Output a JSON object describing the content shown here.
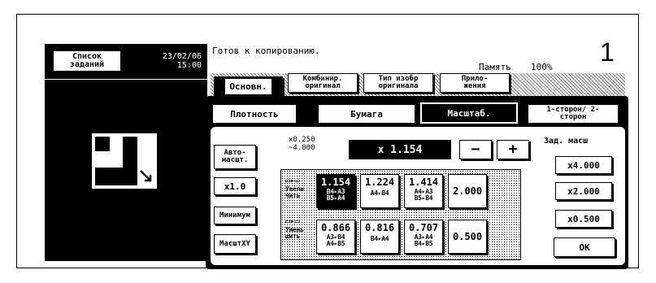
{
  "left_panel": {
    "job_list_label": "Список заданий",
    "date": "23/02/06",
    "time": "15:00"
  },
  "status": {
    "message": "Готов к копированию.",
    "memory_label": "Память",
    "memory_value": "100%",
    "copy_count": "1"
  },
  "main_tabs": {
    "basic": "Основн.",
    "combine": "Комбинир. оригинал",
    "type": "Тип изобр оригинала",
    "app": "Прило- жения"
  },
  "sub_tabs": {
    "density": "Плотность",
    "paper": "Бумага",
    "zoom": "Масштаб.",
    "duplex": "1-сторон/ 2-сторон"
  },
  "zoom": {
    "auto_label": "Авто- масшт.",
    "range": "x0.250 ~4.000",
    "current_value": "x 1.154",
    "minus": "−",
    "plus": "+",
    "x1_label": "x1.0",
    "min_label": "Минимум",
    "xy_label": "МасштXY",
    "enlarge_label": "Увели чить",
    "reduce_label": "Умень шить",
    "enlarge": [
      {
        "value": "1.154",
        "sizes": "B4▸A3 B5▸A4",
        "selected": true
      },
      {
        "value": "1.224",
        "sizes": "A4▸B4"
      },
      {
        "value": "1.414",
        "sizes": "A4▸A3 B5▸B4"
      },
      {
        "value": "2.000",
        "sizes": ""
      }
    ],
    "reduce": [
      {
        "value": "0.866",
        "sizes": "A3▸B4 A4▸B5"
      },
      {
        "value": "0.816",
        "sizes": "B4▸A4"
      },
      {
        "value": "0.707",
        "sizes": "A3▸A4 B4▸B5"
      },
      {
        "value": "0.500",
        "sizes": ""
      }
    ],
    "preset_label": "Зад. масш",
    "preset": [
      "x4.000",
      "x2.000",
      "x0.500"
    ],
    "ok_label": "OK"
  }
}
